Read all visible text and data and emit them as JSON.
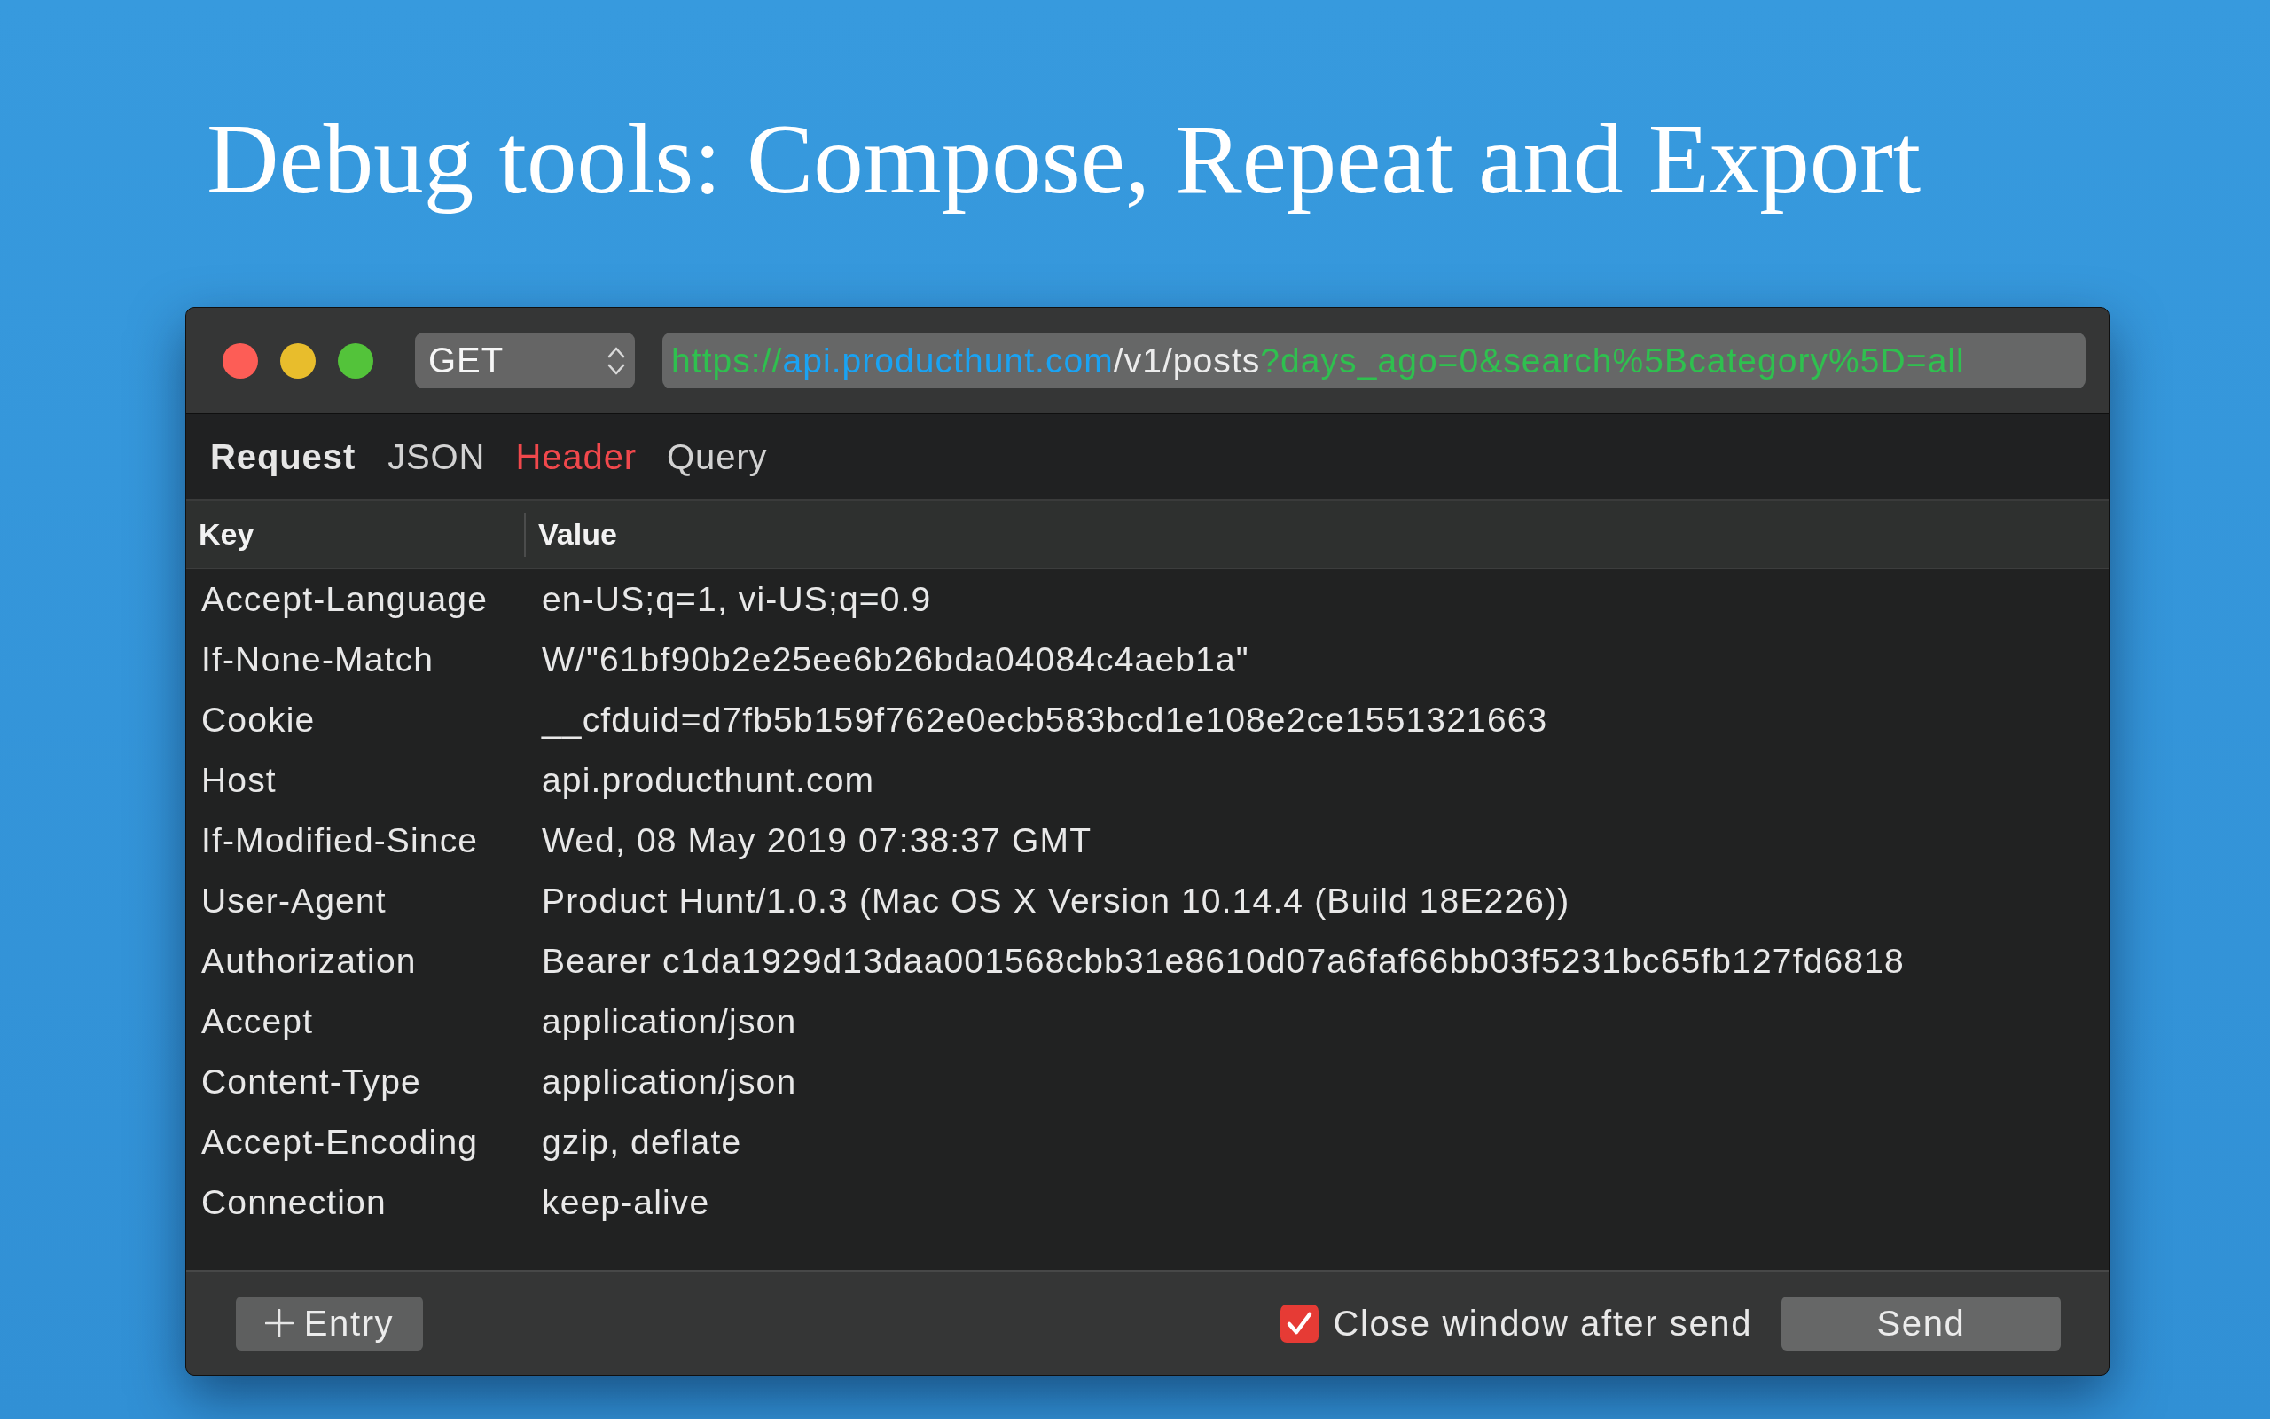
{
  "headline": "Debug tools: Compose, Repeat and Export",
  "window": {
    "method": {
      "value": "GET"
    },
    "url": [
      {
        "kind": "scheme",
        "text": "https://"
      },
      {
        "kind": "host",
        "text": "api.producthunt.com"
      },
      {
        "kind": "path",
        "text": "/v1/posts"
      },
      {
        "kind": "query",
        "text": "?days_ago=0&search%5Bcategory%5D=all"
      }
    ],
    "section_label": "Request",
    "tabs": [
      {
        "label": "JSON",
        "selected": false
      },
      {
        "label": "Header",
        "selected": true
      },
      {
        "label": "Query",
        "selected": false
      }
    ],
    "table": {
      "columns": [
        "Key",
        "Value"
      ],
      "rows": [
        {
          "key": "Accept-Language",
          "value": "en-US;q=1, vi-US;q=0.9"
        },
        {
          "key": "If-None-Match",
          "value": "W/\"61bf90b2e25ee6b26bda04084c4aeb1a\""
        },
        {
          "key": "Cookie",
          "value": "__cfduid=d7fb5b159f762e0ecb583bcd1e108e2ce1551321663"
        },
        {
          "key": "Host",
          "value": "api.producthunt.com"
        },
        {
          "key": "If-Modified-Since",
          "value": "Wed, 08 May 2019 07:38:37 GMT"
        },
        {
          "key": "User-Agent",
          "value": "Product Hunt/1.0.3 (Mac OS X Version 10.14.4 (Build 18E226))"
        },
        {
          "key": "Authorization",
          "value": "Bearer c1da1929d13daa001568cbb31e8610d07a6faf66bb03f5231bc65fb127fd6818"
        },
        {
          "key": "Accept",
          "value": "application/json"
        },
        {
          "key": "Content-Type",
          "value": "application/json"
        },
        {
          "key": "Accept-Encoding",
          "value": "gzip, deflate"
        },
        {
          "key": "Connection",
          "value": "keep-alive"
        }
      ]
    },
    "add_button": {
      "label": "Entry"
    },
    "close_after_send": {
      "label": "Close window after send",
      "checked": true
    },
    "send_button": {
      "label": "Send"
    }
  }
}
